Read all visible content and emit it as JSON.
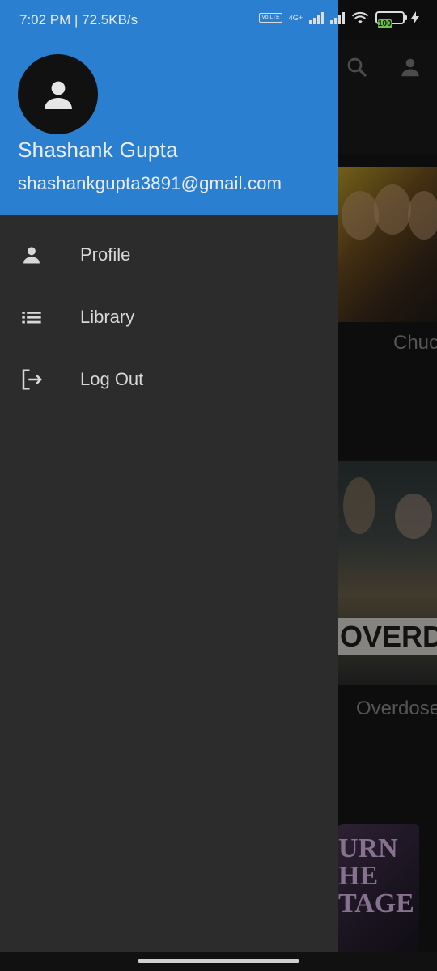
{
  "status_bar": {
    "time_speed": "7:02 PM | 72.5KB/s",
    "network_label": "4G+",
    "volte_label": "Vo LTE",
    "battery_level": "100"
  },
  "drawer": {
    "user": {
      "name": "Shashank Gupta",
      "email": "shashankgupta3891@gmail.com"
    },
    "menu": [
      {
        "label": "Profile",
        "icon": "person-icon"
      },
      {
        "label": "Library",
        "icon": "list-icon"
      },
      {
        "label": "Log Out",
        "icon": "logout-icon"
      }
    ]
  },
  "background": {
    "movies": [
      {
        "title": "Chuc"
      },
      {
        "title": "Overdose",
        "poster_text": "OVERDO"
      },
      {
        "title": "",
        "poster_text": "URN HE TAGE"
      }
    ]
  },
  "colors": {
    "header": "#2a7fd1",
    "drawer": "#2c2c2c",
    "text": "#d8d8d8"
  }
}
